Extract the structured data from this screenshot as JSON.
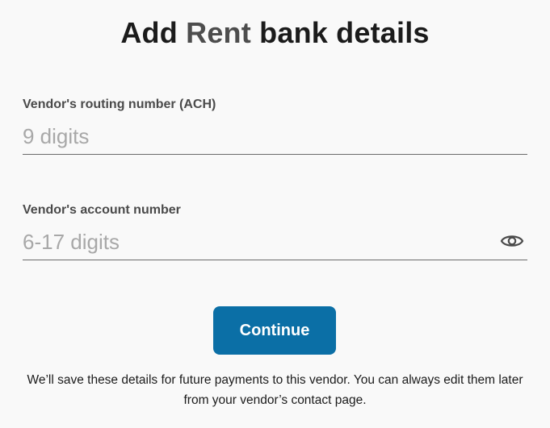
{
  "title": {
    "prefix": "Add",
    "vendor_name": "Rent",
    "suffix": "bank details"
  },
  "routing_field": {
    "label": "Vendor's routing number (ACH)",
    "placeholder": "9 digits",
    "value": ""
  },
  "account_field": {
    "label": "Vendor's account number",
    "placeholder": "6-17 digits",
    "value": "",
    "toggle_icon": "eye-icon"
  },
  "continue_button": {
    "label": "Continue",
    "color": "#0b6fa6"
  },
  "note": "We’ll save these details for future payments to this vendor. You can always edit them later from your vendor’s contact page."
}
